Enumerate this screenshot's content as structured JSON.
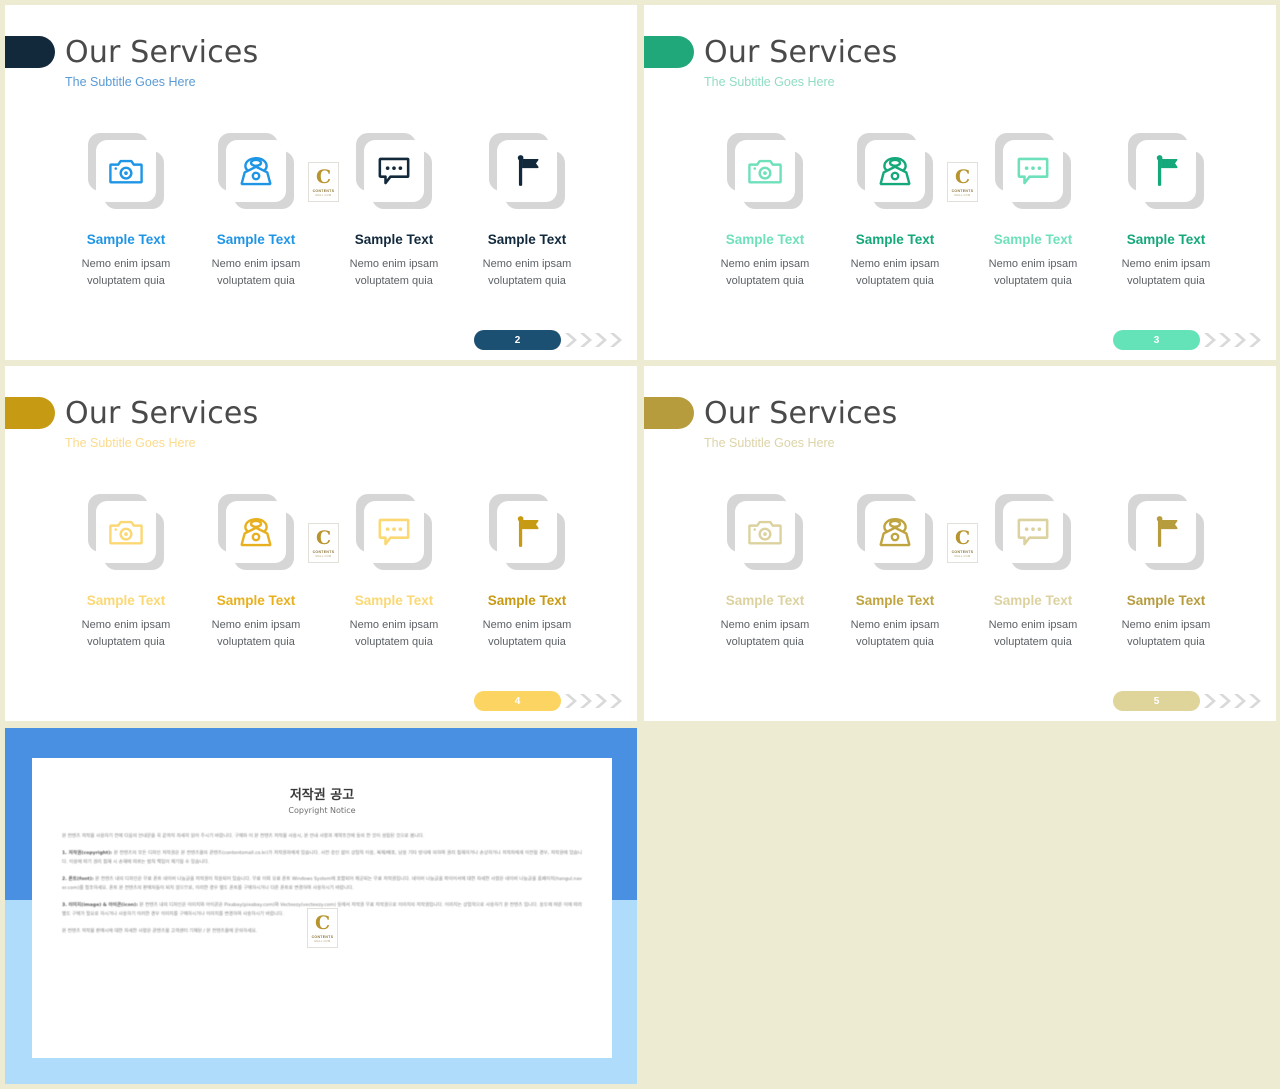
{
  "background_color": "#EDEBD2",
  "slides": [
    {
      "page": "2",
      "title": "Our Services",
      "subtitle": "The Subtitle Goes Here",
      "pill_color": "#12293C",
      "subtitle_color": "#5B9BD5",
      "pager_color": "#1C5073",
      "light_accent": "#1F95E5",
      "dark_accent": "#12293C",
      "items": [
        {
          "icon": "camera-icon",
          "title": "Sample Text",
          "desc_line1": "Nemo enim ipsam",
          "desc_line2": "voluptatem quia",
          "tone": "light"
        },
        {
          "icon": "telephone-icon",
          "title": "Sample Text",
          "desc_line1": "Nemo enim ipsam",
          "desc_line2": "voluptatem quia",
          "tone": "light"
        },
        {
          "icon": "chat-icon",
          "title": "Sample Text",
          "desc_line1": "Nemo enim ipsam",
          "desc_line2": "voluptatem quia",
          "tone": "dark"
        },
        {
          "icon": "flag-icon",
          "title": "Sample Text",
          "desc_line1": "Nemo enim ipsam",
          "desc_line2": "voluptatem quia",
          "tone": "dark"
        }
      ]
    },
    {
      "page": "3",
      "title": "Our Services",
      "subtitle": "The Subtitle Goes Here",
      "pill_color": "#20A87B",
      "subtitle_color": "#8FDCC4",
      "pager_color": "#64E3B8",
      "light_accent": "#6FE0BC",
      "dark_accent": "#15A87A",
      "items": [
        {
          "icon": "camera-icon",
          "title": "Sample Text",
          "desc_line1": "Nemo enim ipsam",
          "desc_line2": "voluptatem quia",
          "tone": "light"
        },
        {
          "icon": "telephone-icon",
          "title": "Sample Text",
          "desc_line1": "Nemo enim ipsam",
          "desc_line2": "voluptatem quia",
          "tone": "dark"
        },
        {
          "icon": "chat-icon",
          "title": "Sample Text",
          "desc_line1": "Nemo enim ipsam",
          "desc_line2": "voluptatem quia",
          "tone": "light"
        },
        {
          "icon": "flag-icon",
          "title": "Sample Text",
          "desc_line1": "Nemo enim ipsam",
          "desc_line2": "voluptatem quia",
          "tone": "dark"
        }
      ]
    },
    {
      "page": "4",
      "title": "Our Services",
      "subtitle": "The Subtitle Goes Here",
      "pill_color": "#C79A14",
      "subtitle_color": "#FBDB8C",
      "pager_color": "#FBD462",
      "light_accent": "#FBD873",
      "dark_accent": "#E8B01E",
      "items": [
        {
          "icon": "camera-icon",
          "title": "Sample Text",
          "desc_line1": "Nemo enim ipsam",
          "desc_line2": "voluptatem quia",
          "tone": "light"
        },
        {
          "icon": "telephone-icon",
          "title": "Sample Text",
          "desc_line1": "Nemo enim ipsam",
          "desc_line2": "voluptatem quia",
          "tone": "dark"
        },
        {
          "icon": "chat-icon",
          "title": "Sample Text",
          "desc_line1": "Nemo enim ipsam",
          "desc_line2": "voluptatem quia",
          "tone": "light"
        },
        {
          "icon": "flag-icon",
          "title": "Sample Text",
          "desc_line1": "Nemo enim ipsam",
          "desc_line2": "voluptatem quia",
          "tone": "darkest"
        }
      ]
    },
    {
      "page": "5",
      "title": "Our Services",
      "subtitle": "The Subtitle Goes Here",
      "pill_color": "#B79C3E",
      "subtitle_color": "#DDD4A8",
      "pager_color": "#DFD49A",
      "light_accent": "#DCD2A0",
      "dark_accent": "#BFA43F",
      "items": [
        {
          "icon": "camera-icon",
          "title": "Sample Text",
          "desc_line1": "Nemo enim ipsam",
          "desc_line2": "voluptatem quia",
          "tone": "light"
        },
        {
          "icon": "telephone-icon",
          "title": "Sample Text",
          "desc_line1": "Nemo enim ipsam",
          "desc_line2": "voluptatem quia",
          "tone": "dark"
        },
        {
          "icon": "chat-icon",
          "title": "Sample Text",
          "desc_line1": "Nemo enim ipsam",
          "desc_line2": "voluptatem quia",
          "tone": "light"
        },
        {
          "icon": "flag-icon",
          "title": "Sample Text",
          "desc_line1": "Nemo enim ipsam",
          "desc_line2": "voluptatem quia",
          "tone": "darkest"
        }
      ]
    }
  ],
  "watermark": {
    "letter": "C",
    "line1": "CONTENTS",
    "line2": "MALL.COM"
  },
  "copyright_panel": {
    "border_color_top": "#4A90E2",
    "border_color_bottom": "#AEDCFA",
    "title": "저작권 공고",
    "subtitle": "Copyright Notice",
    "paragraphs": [
      "본 컨텐츠 저작물 사용하기 전에 다음의 안내문을 꼭 끝까지 자세히 읽어 주시기 바랍니다. 구매자 이 본 컨텐츠 저작물 사용시, 본 안내 사항과 계약조건에 동의 한 것이 성립된 것으로 봅니다.",
      "1. 저작권(copyright): 본 컨텐츠의 모든 디자인 저작권은 본 컨텐츠몰의 콘텐츠(contentsmall.co.kr)가 저작권자에게 있습니다. 사전 승인 없이 상업적 이용, 복제/배포, 남용 기타 방식에 의하여 권리 침해하거나 손상하거나 저작자에게 이전될 경우, 저작권에 있습니다. 이용에 따기 권리 침해 시 손해에 따르는 법적 책임이 제기될 수 있습니다.",
      "2. 폰트(font): 본 컨텐츠 내의 디자인은 무료 폰트 네이버 나눔글꼴 저작권이 적용되어 있습니다. 무료 이외 유료 폰트 Windows System에 포함되어 제공되는 무료 저작권입니다. 네이버 나눔글꼴 파이어서에 대한 자세한 사항은 네이버 나눔글꼴 홈페이지(hangul.naver.com)를 참조하세요. 폰트 본 컨텐츠의 판매자들이 되지 않으므로, 이러한 경우 별도 폰트를 구매하시거나 다른 폰트로 변경하여 사용하시기 바랍니다.",
      "3. 이미지(image) & 아이콘(icon): 본 컨텐츠 내의 디자인은 이미지와 아이콘은 Pixabay(pixabay.com)와 Vecteezy(vecteezy.com) 등에서 저작권 무료 저작권으로 이미지의 저작권입니다. 이미지는 상업적으로 사용하기 본 컨텐츠 입니다. 용도에 따른 이에 따라 별도 구매가 필요로 하시거나 사용하기 이러한 경우 이미지를 구매하시거나 이미지를 변경하여 사용하시기 바랍니다.",
      "본 컨텐츠 저작물 판매시에 대한 자세한 사항은 콘텐츠몰 고객센터 기재된 / 본 컨텐츠몰에 문의하세요."
    ]
  }
}
